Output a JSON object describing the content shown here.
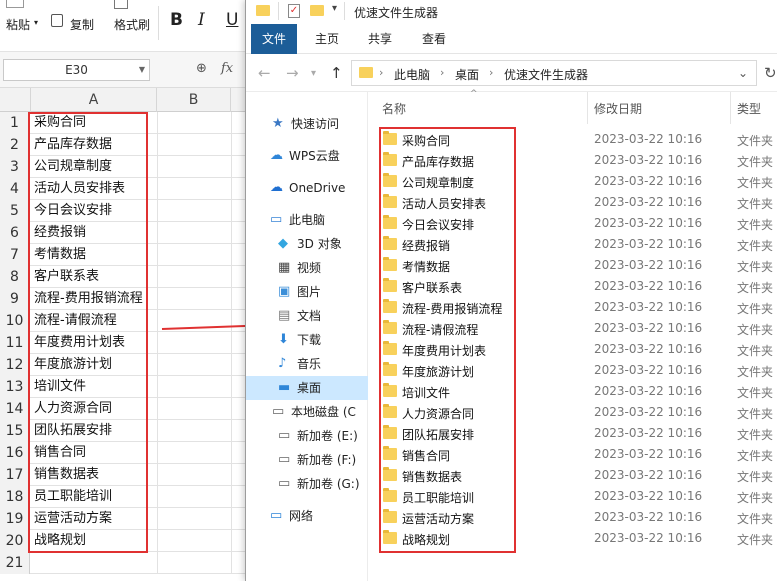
{
  "sheet": {
    "ribbon": {
      "paste": "粘贴",
      "copy": "复制",
      "format_painter": "格式刷",
      "bold": "B",
      "italic": "I",
      "underline": "U"
    },
    "namebox": "E30",
    "fx": "fx",
    "columns": [
      "A",
      "B"
    ],
    "rows": [
      {
        "n": "1",
        "a": "采购合同"
      },
      {
        "n": "2",
        "a": "产品库存数据"
      },
      {
        "n": "3",
        "a": "公司规章制度"
      },
      {
        "n": "4",
        "a": "活动人员安排表"
      },
      {
        "n": "5",
        "a": "今日会议安排"
      },
      {
        "n": "6",
        "a": "经费报销"
      },
      {
        "n": "7",
        "a": "考情数据"
      },
      {
        "n": "8",
        "a": "客户联系表"
      },
      {
        "n": "9",
        "a": "流程-费用报销流程"
      },
      {
        "n": "10",
        "a": "流程-请假流程"
      },
      {
        "n": "11",
        "a": "年度费用计划表"
      },
      {
        "n": "12",
        "a": "年度旅游计划"
      },
      {
        "n": "13",
        "a": "培训文件"
      },
      {
        "n": "14",
        "a": "人力资源合同"
      },
      {
        "n": "15",
        "a": "团队拓展安排"
      },
      {
        "n": "16",
        "a": "销售合同"
      },
      {
        "n": "17",
        "a": "销售数据表"
      },
      {
        "n": "18",
        "a": "员工职能培训"
      },
      {
        "n": "19",
        "a": "运营活动方案"
      },
      {
        "n": "20",
        "a": "战略规划"
      },
      {
        "n": "21",
        "a": ""
      }
    ]
  },
  "explorer": {
    "title": "优速文件生成器",
    "menu": [
      "文件",
      "主页",
      "共享",
      "查看"
    ],
    "breadcrumb": [
      "此电脑",
      "桌面",
      "优速文件生成器"
    ],
    "nav": [
      {
        "label": "快速访问",
        "icon": "star-icon"
      },
      {
        "label": "WPS云盘",
        "icon": "cloud-icon"
      },
      {
        "label": "OneDrive",
        "icon": "onedrive-icon"
      },
      {
        "label": "此电脑",
        "icon": "computer-icon"
      },
      {
        "label": "3D 对象",
        "icon": "cube-icon"
      },
      {
        "label": "视频",
        "icon": "video-icon"
      },
      {
        "label": "图片",
        "icon": "picture-icon"
      },
      {
        "label": "文档",
        "icon": "document-icon"
      },
      {
        "label": "下载",
        "icon": "download-icon"
      },
      {
        "label": "音乐",
        "icon": "music-icon"
      },
      {
        "label": "桌面",
        "icon": "desktop-icon"
      },
      {
        "label": "本地磁盘 (C",
        "icon": "drive-icon"
      },
      {
        "label": "新加卷 (E:)",
        "icon": "drive-icon"
      },
      {
        "label": "新加卷 (F:)",
        "icon": "drive-icon"
      },
      {
        "label": "新加卷 (G:)",
        "icon": "drive-icon"
      },
      {
        "label": "网络",
        "icon": "network-icon"
      }
    ],
    "columns": {
      "name": "名称",
      "date": "修改日期",
      "type": "类型"
    },
    "files": [
      {
        "name": "采购合同",
        "date": "2023-03-22 10:16",
        "type": "文件夹"
      },
      {
        "name": "产品库存数据",
        "date": "2023-03-22 10:16",
        "type": "文件夹"
      },
      {
        "name": "公司规章制度",
        "date": "2023-03-22 10:16",
        "type": "文件夹"
      },
      {
        "name": "活动人员安排表",
        "date": "2023-03-22 10:16",
        "type": "文件夹"
      },
      {
        "name": "今日会议安排",
        "date": "2023-03-22 10:16",
        "type": "文件夹"
      },
      {
        "name": "经费报销",
        "date": "2023-03-22 10:16",
        "type": "文件夹"
      },
      {
        "name": "考情数据",
        "date": "2023-03-22 10:16",
        "type": "文件夹"
      },
      {
        "name": "客户联系表",
        "date": "2023-03-22 10:16",
        "type": "文件夹"
      },
      {
        "name": "流程-费用报销流程",
        "date": "2023-03-22 10:16",
        "type": "文件夹"
      },
      {
        "name": "流程-请假流程",
        "date": "2023-03-22 10:16",
        "type": "文件夹"
      },
      {
        "name": "年度费用计划表",
        "date": "2023-03-22 10:16",
        "type": "文件夹"
      },
      {
        "name": "年度旅游计划",
        "date": "2023-03-22 10:16",
        "type": "文件夹"
      },
      {
        "name": "培训文件",
        "date": "2023-03-22 10:16",
        "type": "文件夹"
      },
      {
        "name": "人力资源合同",
        "date": "2023-03-22 10:16",
        "type": "文件夹"
      },
      {
        "name": "团队拓展安排",
        "date": "2023-03-22 10:16",
        "type": "文件夹"
      },
      {
        "name": "销售合同",
        "date": "2023-03-22 10:16",
        "type": "文件夹"
      },
      {
        "name": "销售数据表",
        "date": "2023-03-22 10:16",
        "type": "文件夹"
      },
      {
        "name": "员工职能培训",
        "date": "2023-03-22 10:16",
        "type": "文件夹"
      },
      {
        "name": "运营活动方案",
        "date": "2023-03-22 10:16",
        "type": "文件夹"
      },
      {
        "name": "战略规划",
        "date": "2023-03-22 10:16",
        "type": "文件夹"
      }
    ]
  },
  "colors": {
    "highlight_box": "#e03131",
    "file_tab": "#1c5d98",
    "folder": "#f8d15c",
    "nav_selected": "#cce8ff"
  }
}
